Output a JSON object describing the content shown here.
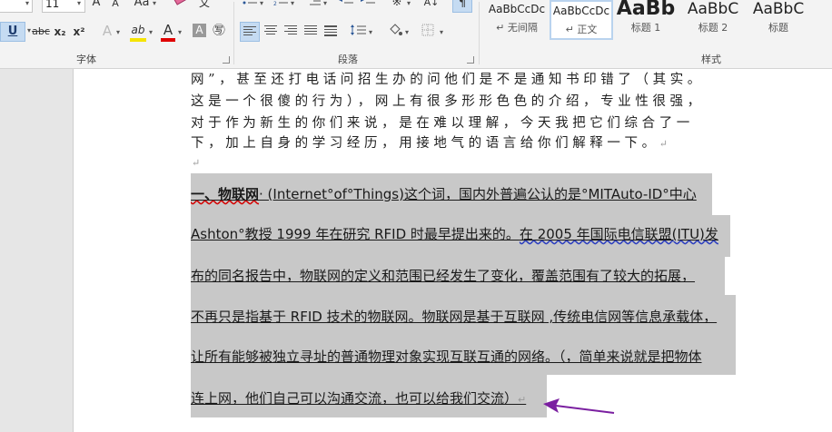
{
  "ribbon": {
    "font_group": {
      "font_size": "11",
      "grow_label": "A",
      "shrink_label": "A",
      "case_label": "Aa",
      "underline_label": "U",
      "strike_label": "abc",
      "sub_label": "x₂",
      "sup_label": "x²",
      "effects_label": "A",
      "highlight_label": "ab",
      "font_color_label": "A",
      "shading_label": "A",
      "enclose_label": "㊢",
      "group_name": "字体",
      "highlight_color": "#f5e400",
      "font_color": "#e00000"
    },
    "paragraph_group": {
      "group_name": "段落"
    },
    "styles_group": {
      "group_name": "样式",
      "items": [
        {
          "sample": "AaBbCcDc",
          "name": "↵ 无间隔"
        },
        {
          "sample": "AaBbCcDc",
          "name": "↵ 正文"
        },
        {
          "sample": "AaBb",
          "name": "标题 1"
        },
        {
          "sample": "AaBbC",
          "name": "标题 2"
        },
        {
          "sample": "AaBbC",
          "name": "标题"
        }
      ]
    }
  },
  "document": {
    "paragraph1": [
      "网”，甚至还打电话问招生办的问他们是不是通知书印错了（其实。",
      "这是一个很傻的行为），网上有很多形形色色的介绍，专业性很强，",
      "对于作为新生的你们来说，是在难以理解，今天我把它们综合了一",
      "下，加上自身的学习经历，用接地气的语言给你们解释一下。"
    ],
    "para_mark": "↵",
    "selected_lines": [
      {
        "a": "一、物联网",
        "b": "· (Internet°of°Things)这个词，国内外普遍公认的是°MITAuto-ID°中心"
      },
      {
        "a": "Ashton°教授 1999 年在研究 RFID 时最早提出来的。",
        "b": "在 2005 年国际电信联盟(ITU)发"
      },
      {
        "a": "布的同名报告中，物联网的定义和范围已经发生了变化，覆盖范围有了较大的拓展，"
      },
      {
        "a": "不再只是指基于 RFID 技术的物联网。物联网是基于互联网 ,传统电信网等信息承载体，"
      },
      {
        "a": "让所有能够被独立寻址的普通物理对象实现互联互通的网络。（，简单来说就是把物体"
      },
      {
        "a": "连上网，他们自己可以沟通交流，也可以给我们交流）"
      }
    ],
    "arrow_color": "#7a1fa0"
  }
}
